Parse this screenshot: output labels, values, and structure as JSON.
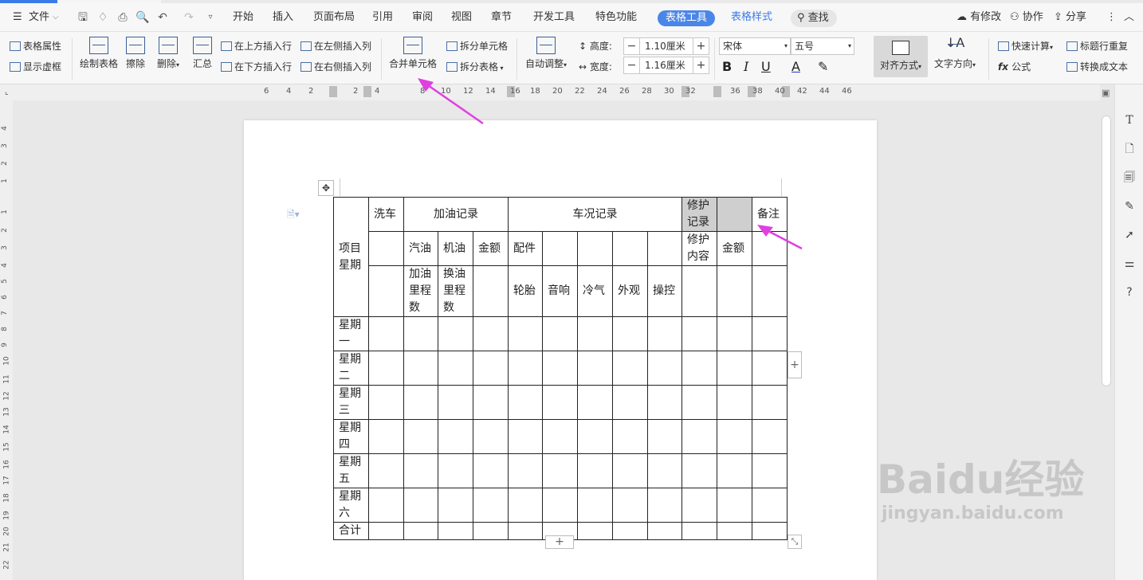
{
  "menubar": {
    "file": "文件",
    "tabs": [
      "开始",
      "插入",
      "页面布局",
      "引用",
      "审阅",
      "视图",
      "章节",
      "开发工具",
      "特色功能"
    ],
    "active_tab": "表格工具",
    "tab_style": "表格样式",
    "search": "查找",
    "has_changes": "有修改",
    "collab": "协作",
    "share": "分享"
  },
  "ribbon": {
    "table_props": "表格属性",
    "show_gridlines": "显示虚框",
    "draw_table": "绘制表格",
    "erase": "擦除",
    "delete": "删除",
    "summary": "汇总",
    "insert_above": "在上方插入行",
    "insert_below": "在下方插入行",
    "insert_left": "在左侧插入列",
    "insert_right": "在右侧插入列",
    "merge_cells": "合并单元格",
    "split_cells": "拆分单元格",
    "split_table": "拆分表格",
    "auto_adjust": "自动调整",
    "height_label": "高度:",
    "height_value": "1.10厘米",
    "width_label": "宽度:",
    "width_value": "1.16厘米",
    "font_name": "宋体",
    "font_size": "五号",
    "bold": "B",
    "italic": "I",
    "underline": "U",
    "font_color": "A",
    "align": "对齐方式",
    "text_direction": "文字方向",
    "quick_calc": "快速计算",
    "title_repeat": "标题行重复",
    "formula": "公式",
    "to_text": "转换成文本"
  },
  "ruler": [
    "6",
    "4",
    "2",
    "2",
    "4",
    "8",
    "10",
    "12",
    "14",
    "16",
    "18",
    "20",
    "22",
    "24",
    "26",
    "28",
    "30",
    "32",
    "36",
    "38",
    "40",
    "42",
    "44",
    "46"
  ],
  "vruler": [
    "4",
    "3",
    "2",
    "1",
    "1",
    "2",
    "3",
    "4",
    "5",
    "6",
    "7",
    "8",
    "9",
    "10",
    "11",
    "12",
    "13",
    "14",
    "15",
    "16",
    "17",
    "18",
    "19",
    "20",
    "21",
    "22"
  ],
  "table": {
    "r1": {
      "wash": "洗车",
      "fuel_record": "加油记录",
      "car_status": "车况记录",
      "repair_record": "修护记录",
      "note": "备注"
    },
    "item_week": "项目星期",
    "r2": {
      "gasoline": "汽油",
      "engine_oil": "机油",
      "amount": "金额",
      "parts": "配件",
      "repair_content": "修护内容",
      "repair_amount": "金额"
    },
    "r3": {
      "fuel_mileage": "加油里程数",
      "oil_change_mileage": "换油里程数",
      "tire": "轮胎",
      "audio": "音响",
      "ac": "冷气",
      "exterior": "外观",
      "control": "操控"
    },
    "days": [
      "星期一",
      "星期二",
      "星期三",
      "星期四",
      "星期五",
      "星期六"
    ],
    "total": "合计"
  },
  "controls": {
    "add": "+"
  },
  "watermark": {
    "brand": "Baidu经验",
    "url": "jingyan.baidu.com"
  },
  "colors": {
    "accent": "#4a86e8",
    "arrow": "#e040e0",
    "selected_cell": "#cfcfcf"
  }
}
